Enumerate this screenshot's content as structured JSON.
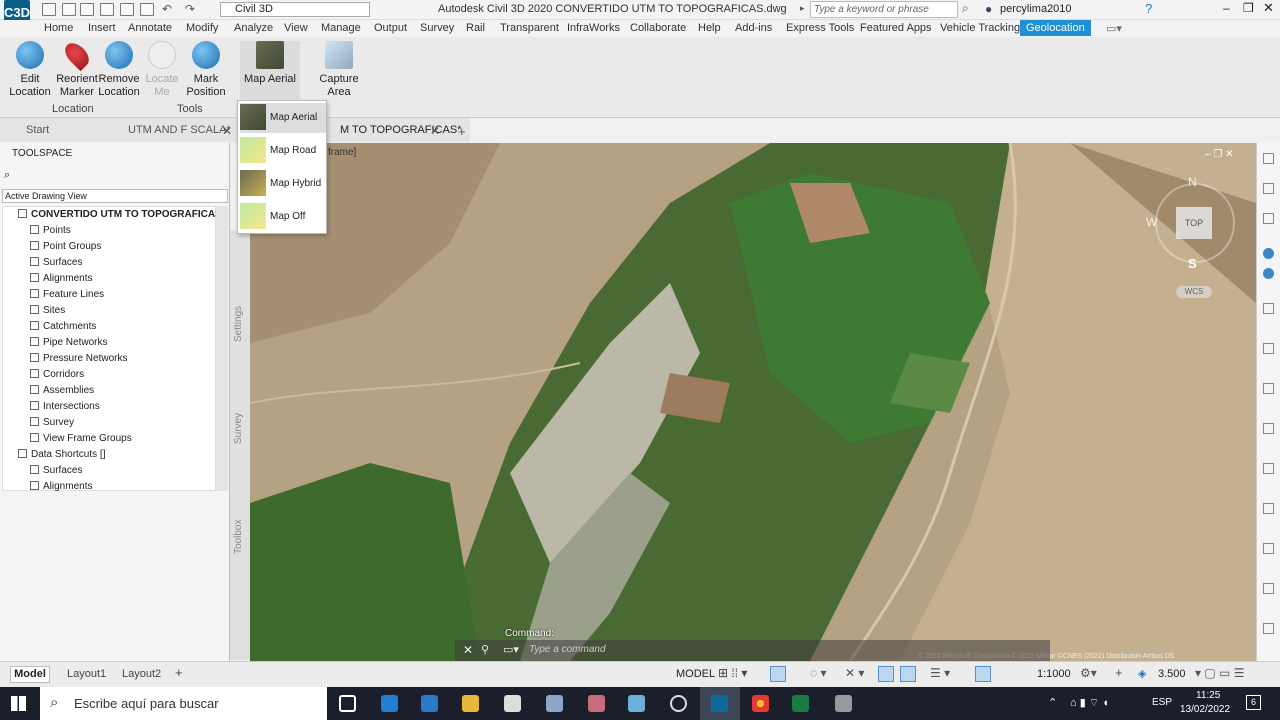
{
  "app": {
    "logo": "C3D",
    "workspace": "Civil 3D",
    "title": "Autodesk Civil 3D 2020    CONVERTIDO UTM TO TOPOGRAFICAS.dwg",
    "search_placeholder": "Type a keyword or phrase",
    "user": "percylima2010"
  },
  "ribbon_tabs": [
    "Home",
    "Insert",
    "Annotate",
    "Modify",
    "Analyze",
    "View",
    "Manage",
    "Output",
    "Survey",
    "Rail",
    "Transparent",
    "InfraWorks",
    "Collaborate",
    "Help",
    "Add-ins",
    "Express Tools",
    "Featured Apps",
    "Vehicle Tracking",
    "Geolocation"
  ],
  "ribbon": {
    "location": {
      "title": "Location",
      "edit": "Edit\nLocation",
      "reorient": "Reorient\nMarker",
      "remove": "Remove\nLocation"
    },
    "tools": {
      "title": "Tools",
      "locate": "Locate\nMe",
      "mark": "Mark\nPosition"
    },
    "map_aerial": "Map Aerial",
    "capture": "Capture\nArea"
  },
  "map_dropdown": [
    "Map Aerial",
    "Map Road",
    "Map Hybrid",
    "Map Off"
  ],
  "doc_tabs": {
    "start": "Start",
    "tab1": "UTM AND F SCALA*",
    "tab2": "M TO TOPOGRAFICAS*"
  },
  "toolspace": {
    "title": "TOOLSPACE",
    "view": "Active Drawing View",
    "root": "CONVERTIDO UTM TO TOPOGRAFICAS",
    "items": [
      "Points",
      "Point Groups",
      "Surfaces",
      "Alignments",
      "Feature Lines",
      "Sites",
      "Catchments",
      "Pipe Networks",
      "Pressure Networks",
      "Corridors",
      "Assemblies",
      "Intersections",
      "Survey",
      "View Frame Groups"
    ],
    "shortcuts": "Data Shortcuts []",
    "shortcut_items": [
      "Surfaces",
      "Alignments"
    ]
  },
  "side_tabs": [
    "Settings",
    "Survey",
    "Toolbox"
  ],
  "viewport_label": "frame]",
  "viewcube": {
    "n": "N",
    "w": "W",
    "s": "S",
    "top": "TOP",
    "wcs": "WCS"
  },
  "copyright": "© 2022 Microsoft Corporation © 2022 Maxar ©CNES (2022) Distribution Airbus DS",
  "command": {
    "label": "Command:",
    "placeholder": "Type a command"
  },
  "layout_tabs": [
    "Model",
    "Layout1",
    "Layout2"
  ],
  "status": {
    "model": "MODEL",
    "scale": "1:1000",
    "value": "3.500"
  },
  "taskbar": {
    "search": "Escribe aquí para buscar",
    "lang": "ESP",
    "time": "11:25",
    "date": "13/02/2022",
    "badge": "6"
  }
}
